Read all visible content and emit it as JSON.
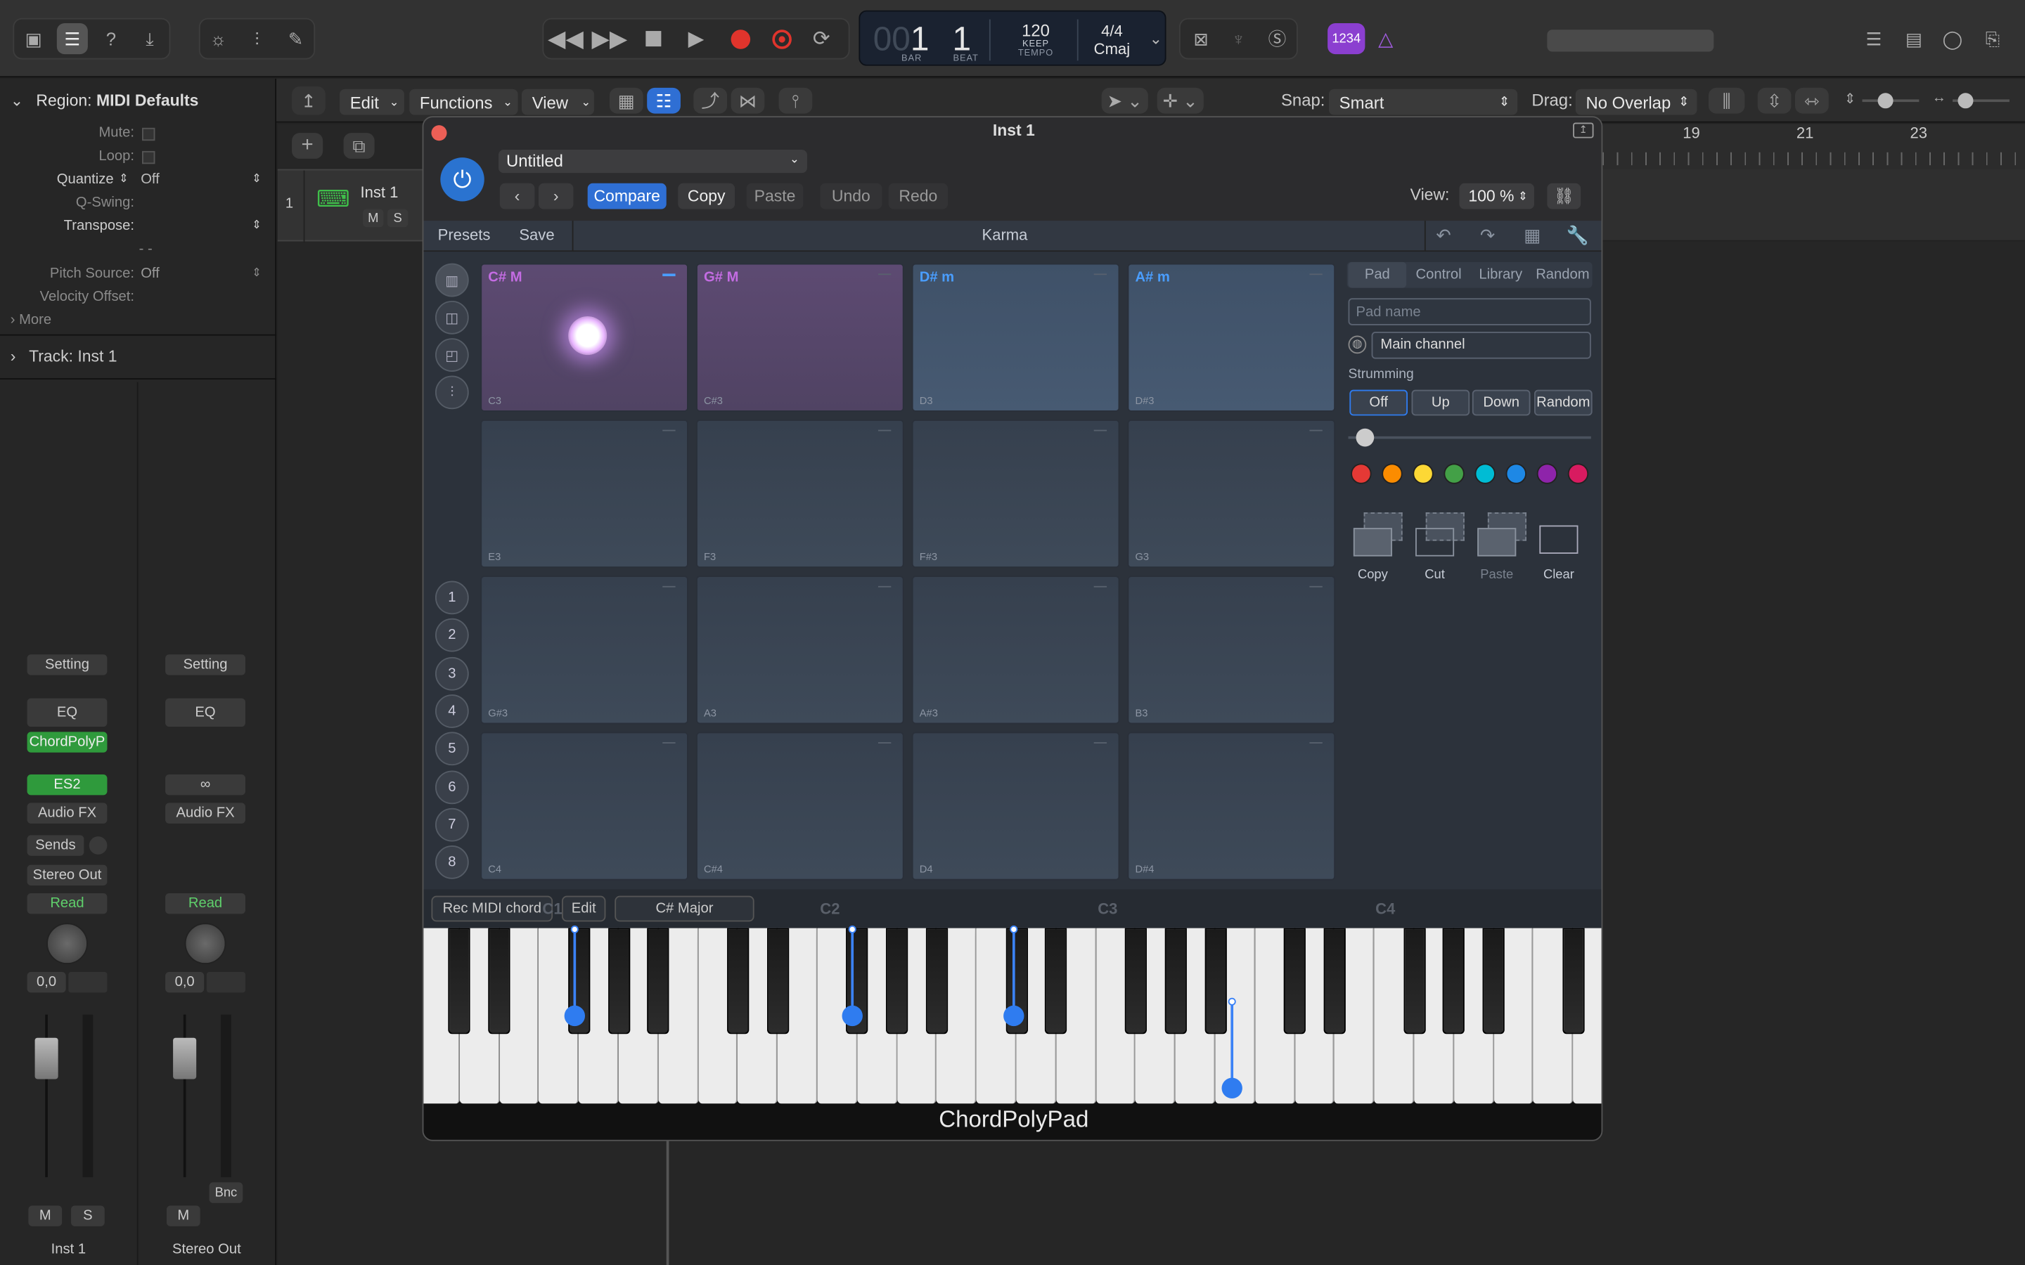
{
  "toolbar": {
    "lcd": {
      "bar_dim": "00",
      "bar": "1",
      "beat": "1",
      "tempo": "120",
      "keep": "KEEP",
      "bar_label": "BAR",
      "beat_label": "BEAT",
      "tempo_label": "TEMPO",
      "signature": "4/4",
      "key": "Cmaj"
    },
    "badge": "1234"
  },
  "editbar": {
    "menus": [
      "Edit",
      "Functions",
      "View"
    ],
    "snap_label": "Snap:",
    "snap_value": "Smart",
    "drag_label": "Drag:",
    "drag_value": "No Overlap"
  },
  "inspector": {
    "region_label": "Region:",
    "region_name": "MIDI Defaults",
    "rows": [
      {
        "k": "Mute:",
        "v": ""
      },
      {
        "k": "Loop:",
        "v": ""
      },
      {
        "k": "Quantize",
        "v": "Off"
      },
      {
        "k": "Q-Swing:",
        "v": ""
      },
      {
        "k": "Transpose:",
        "v": ""
      },
      {
        "k": "- -",
        "v": ""
      },
      {
        "k": "Pitch Source:",
        "v": "Off"
      },
      {
        "k": "Velocity Offset:",
        "v": ""
      }
    ],
    "more": "More",
    "track_label": "Track:",
    "track_name": "Inst 1"
  },
  "tracklist": {
    "index": "1",
    "track": "Inst 1",
    "mute": "M",
    "solo": "S"
  },
  "ruler": [
    "19",
    "21",
    "23"
  ],
  "strips": [
    {
      "setting": "Setting",
      "eq": "EQ",
      "plugin": "ChordPolyP",
      "instrument": "ES2",
      "audiofx": "Audio FX",
      "sends": "Sends",
      "output": "Stereo Out",
      "auto": "Read",
      "val": "0,0",
      "m": "M",
      "s": "S",
      "name": "Inst 1"
    },
    {
      "setting": "Setting",
      "eq": "EQ",
      "plugin": "",
      "instrument": "",
      "audiofx": "Audio FX",
      "sends": "",
      "output": "",
      "auto": "Read",
      "val": "0,0",
      "m": "M",
      "s": "",
      "bnc": "Bnc",
      "name": "Stereo Out"
    }
  ],
  "plugin": {
    "title": "Inst 1",
    "preset": "Untitled",
    "compare": "Compare",
    "copy": "Copy",
    "paste": "Paste",
    "undo": "Undo",
    "redo": "Redo",
    "view_label": "View:",
    "view_value": "100 %",
    "presets": "Presets",
    "save": "Save",
    "name": "Karma",
    "pads": [
      {
        "name": "C# M",
        "note": "C3"
      },
      {
        "name": "G# M",
        "note": "C#3"
      },
      {
        "name": "D# m",
        "note": "D3"
      },
      {
        "name": "A# m",
        "note": "D#3"
      },
      {
        "name": "",
        "note": "E3"
      },
      {
        "name": "",
        "note": "F3"
      },
      {
        "name": "",
        "note": "F#3"
      },
      {
        "name": "",
        "note": "G3"
      },
      {
        "name": "",
        "note": "G#3"
      },
      {
        "name": "",
        "note": "A3"
      },
      {
        "name": "",
        "note": "A#3"
      },
      {
        "name": "",
        "note": "B3"
      },
      {
        "name": "",
        "note": "C4"
      },
      {
        "name": "",
        "note": "C#4"
      },
      {
        "name": "",
        "note": "D4"
      },
      {
        "name": "",
        "note": "D#4"
      }
    ],
    "banks": [
      "1",
      "2",
      "3",
      "4",
      "5",
      "6",
      "7",
      "8"
    ],
    "right": {
      "tabs": [
        "Pad",
        "Control",
        "Library",
        "Random"
      ],
      "pad_name_placeholder": "Pad name",
      "channel": "Main channel",
      "strumming": "Strumming",
      "strum_options": [
        "Off",
        "Up",
        "Down",
        "Random"
      ],
      "colors": [
        "#e53935",
        "#fb8c00",
        "#fdd835",
        "#43a047",
        "#00bcd4",
        "#1e88e5",
        "#8e24aa",
        "#d81b60"
      ],
      "clip": [
        "Copy",
        "Cut",
        "Paste",
        "Clear"
      ]
    },
    "rec": "Rec MIDI chord",
    "edit": "Edit",
    "chord": "C# Major",
    "octaves": [
      "C1",
      "C2",
      "C3",
      "C4"
    ],
    "footer": "ChordPolyPad"
  }
}
